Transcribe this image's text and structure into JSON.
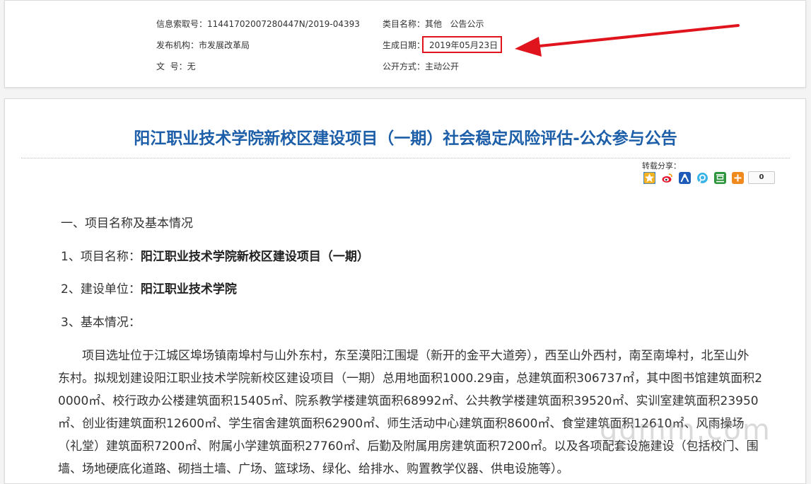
{
  "meta": {
    "info_index_label": "信息索取号：",
    "info_index_value": "11441702007280447N/2019-04393",
    "category_label": "类目名称：",
    "category_value": "其他   公告公示",
    "publisher_label": "发布机构：",
    "publisher_value": "市发展改革局",
    "date_label": "生成日期：",
    "date_value": "2019年05月23日",
    "doc_no_label": "文  号：",
    "doc_no_value": "无",
    "disclosure_label": "公开方式：",
    "disclosure_value": "主动公开"
  },
  "annotation": {
    "highlight_color": "#e0141c"
  },
  "article": {
    "title": "阳江职业技术学院新校区建设项目（一期）社会稳定风险评估-公众参与公告",
    "share_label": "转载分享：",
    "share_count": "0",
    "share_icons": [
      "qzone-icon",
      "weibo-icon",
      "renren-icon",
      "tqq-icon",
      "douban-icon",
      "more-share-icon"
    ],
    "section1": "一、项目名称及基本情况",
    "item1_label": "1、项目名称：",
    "item1_value": "阳江职业技术学院新校区建设项目（一期）",
    "item2_label": "2、建设单位：",
    "item2_value": "阳江职业技术学院",
    "item3_label": "3、基本情况：",
    "body_lines": [
      "　　项目选址位于江城区埠场镇南埠村与山外东村，东至漠阳江围堤（新开的金平大道旁），西至山外西村，南至南埠村，北至山外",
      "东村。拟规划建设阳江职业技术学院新校区建设项目（一期）总用地面积1000.29亩，总建筑面积306737㎡，其中图书馆建筑面积2",
      "0000㎡、校行政办公楼建筑面积15405㎡、院系教学楼建筑面积68992㎡、公共教学楼建筑面积39520㎡、实训室建筑面积23950",
      "㎡、创业街建筑面积12600㎡、学生宿舍建筑面积62900㎡、师生活动中心建筑面积8600㎡、食堂建筑面积12610㎡、风雨操场",
      "（礼堂）建筑面积7200㎡、附属小学建筑面积27760㎡、后勤及附属用房建筑面积7200㎡。以及各项配套设施建设（包括校门、围",
      "墙、场地硬底化道路、砌挡土墙、广场、篮球场、绿化、给排水、购置教学仪器、供电设施等）。"
    ]
  },
  "watermark": "gdmm.com",
  "colors": {
    "title": "#1c5ea8",
    "accent_red": "#e0141c"
  }
}
